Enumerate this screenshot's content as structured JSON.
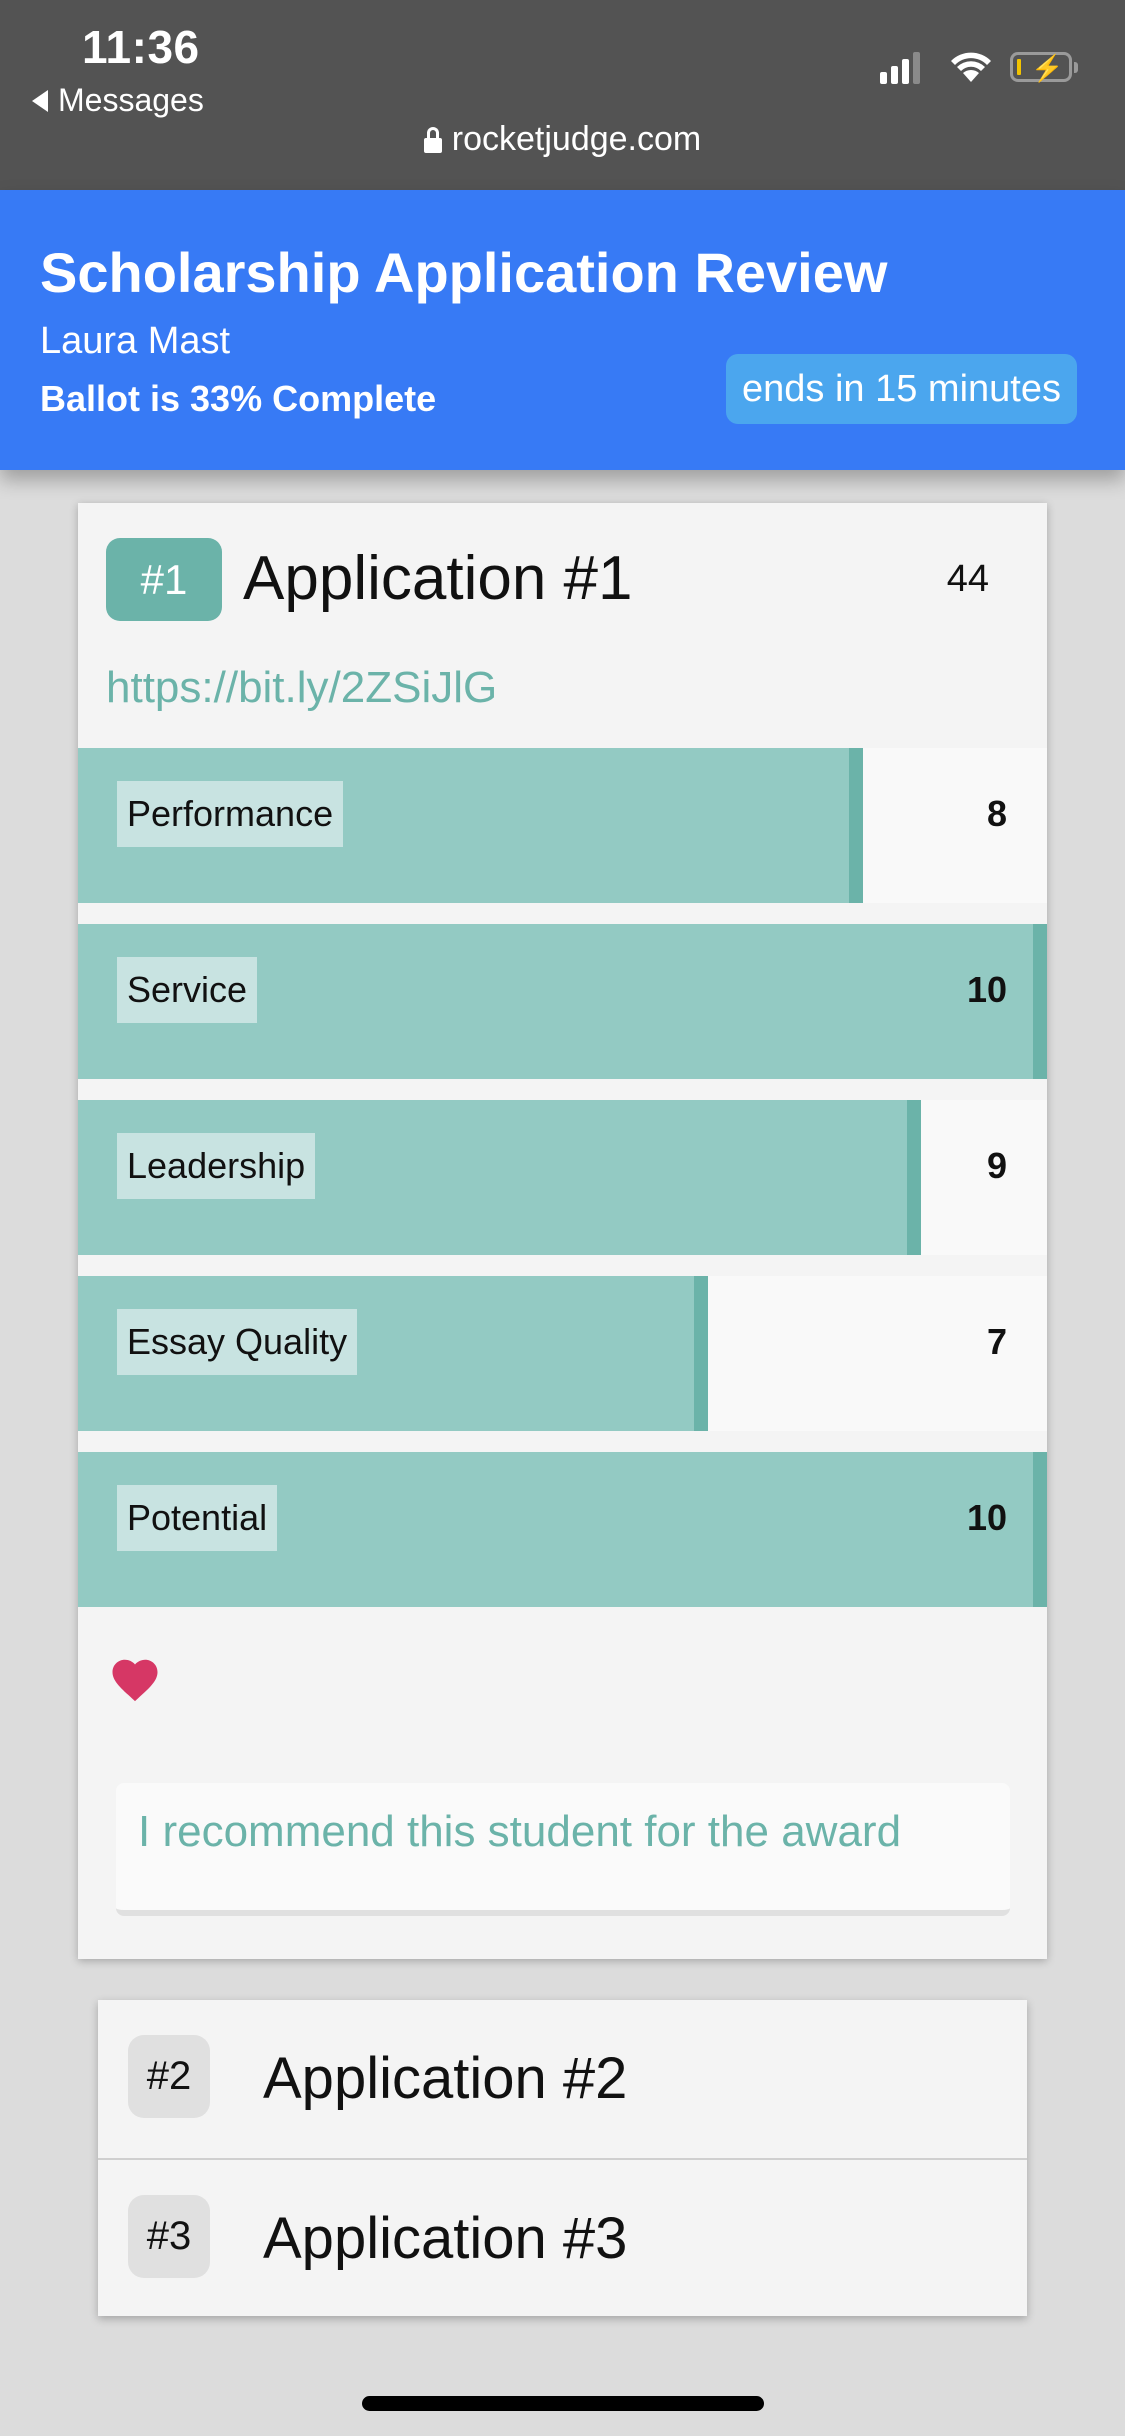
{
  "status_bar": {
    "time": "11:36",
    "back_label": "Messages",
    "url": "rocketjudge.com",
    "icons": [
      "signal-icon",
      "wifi-icon",
      "battery-charging-icon",
      "lock-icon"
    ]
  },
  "header": {
    "title": "Scholarship Application Review",
    "user": "Laura Mast",
    "progress_text": "Ballot is 33% Complete",
    "progress_percent": 33,
    "timer": "ends in 15 minutes",
    "color": "#377af5"
  },
  "active_application": {
    "rank": "#1",
    "title": "Application #1",
    "total_score": "44",
    "link": "https://bit.ly/2ZSiJlG",
    "criteria": [
      {
        "label": "Performance",
        "value": 8,
        "fill_fraction": 0.81
      },
      {
        "label": "Service",
        "value": 10,
        "fill_fraction": 1.0
      },
      {
        "label": "Leadership",
        "value": 9,
        "fill_fraction": 0.87
      },
      {
        "label": "Essay Quality",
        "value": 7,
        "fill_fraction": 0.65
      },
      {
        "label": "Potential",
        "value": 10,
        "fill_fraction": 1.0
      }
    ],
    "favorite": true,
    "comment": "I recommend this student for the award",
    "accent_color": "#6bb3a9",
    "heart_color": "#d63765"
  },
  "other_applications": [
    {
      "rank": "#2",
      "title": "Application #2"
    },
    {
      "rank": "#3",
      "title": "Application #3"
    }
  ]
}
